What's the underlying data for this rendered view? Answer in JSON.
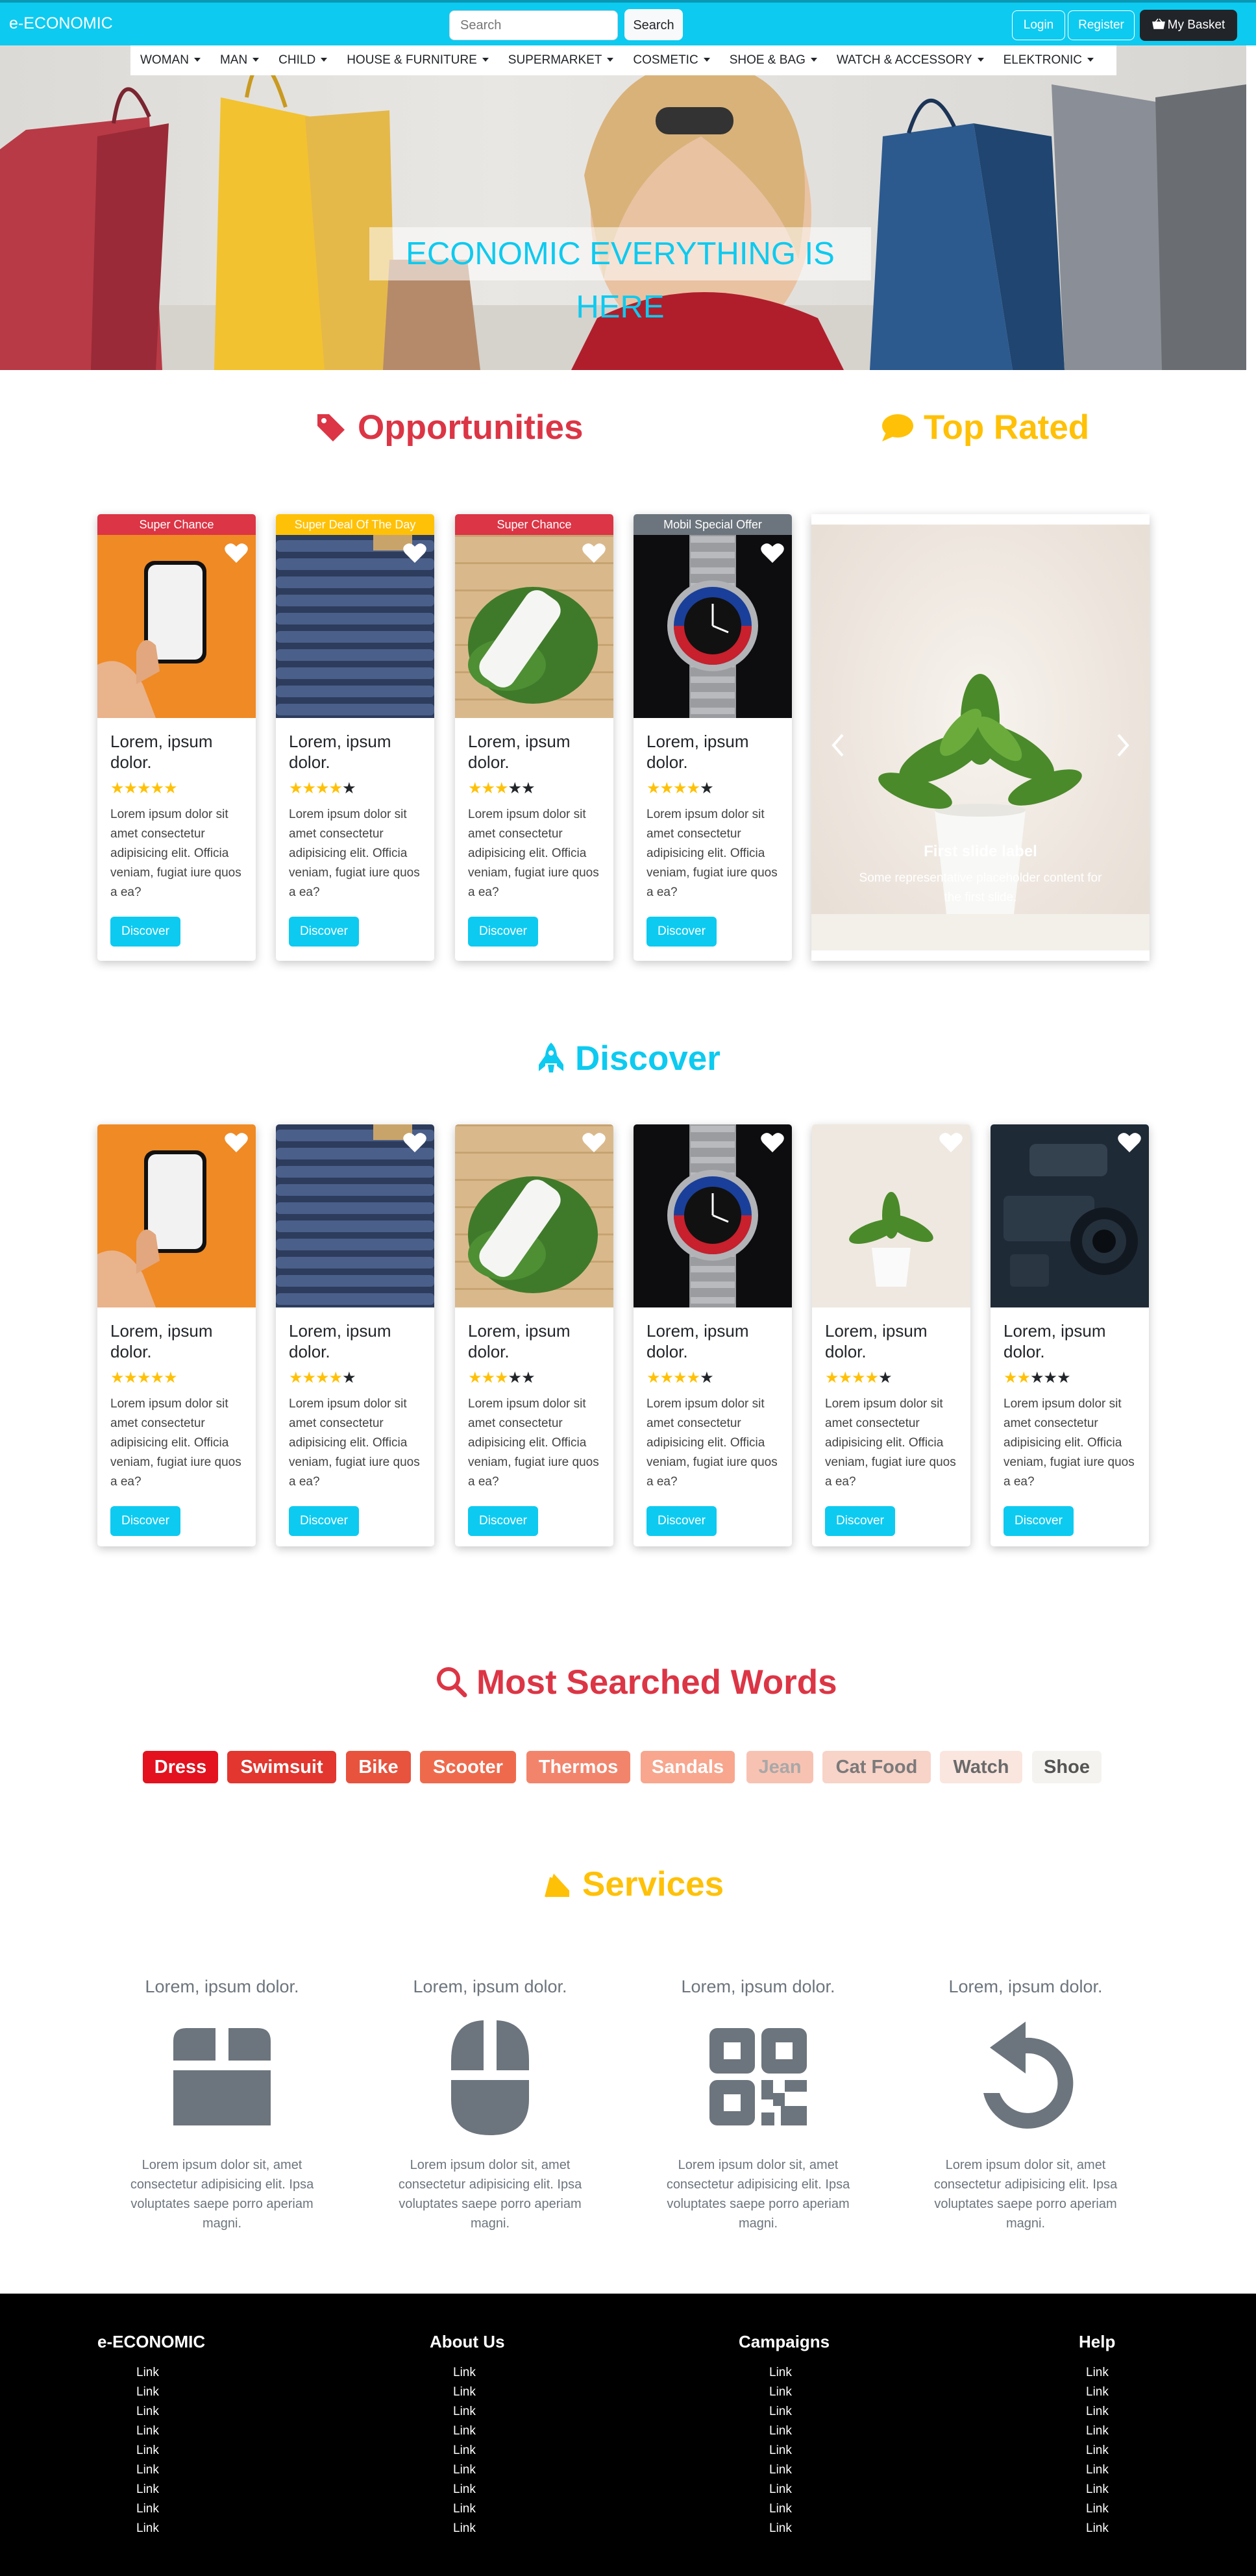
{
  "navbar": {
    "brand": "e-ECONOMIC",
    "search_placeholder": "Search",
    "search_button": "Search",
    "login": "Login",
    "register": "Register",
    "basket": "My Basket",
    "accent_color": "#0dcaf0"
  },
  "categories": [
    "WOMAN",
    "MAN",
    "CHILD",
    "HOUSE & FURNITURE",
    "SUPERMARKET",
    "COSMETIC",
    "SHOE & BAG",
    "WATCH & ACCESSORY",
    "ELEKTRONIC"
  ],
  "hero": {
    "title": "ECONOMIC EVERYTHING IS HERE"
  },
  "opportunities": {
    "title": "Opportunities",
    "icon": "tags-icon",
    "color": "#dc3545",
    "cards": [
      {
        "ribbon": "Super Chance",
        "ribbon_color": "#dc3545",
        "title": "Lorem, ipsum dolor.",
        "rating": 5,
        "text": "Lorem ipsum dolor sit amet consectetur adipisicing elit. Officia veniam, fugiat iure quos a ea?",
        "button": "Discover",
        "image": "phone-image"
      },
      {
        "ribbon": "Super Deal Of The Day",
        "ribbon_color": "#ffc107",
        "title": "Lorem, ipsum dolor.",
        "rating": 4,
        "text": "Lorem ipsum dolor sit amet consectetur adipisicing elit. Officia veniam, fugiat iure quos a ea?",
        "button": "Discover",
        "image": "jeans-image"
      },
      {
        "ribbon": "Super Chance",
        "ribbon_color": "#dc3545",
        "title": "Lorem, ipsum dolor.",
        "rating": 3,
        "text": "Lorem ipsum dolor sit amet consectetur adipisicing elit. Officia veniam, fugiat iure quos a ea?",
        "button": "Discover",
        "image": "cream-image"
      },
      {
        "ribbon": "Mobil Special Offer",
        "ribbon_color": "#6c757d",
        "title": "Lorem, ipsum dolor.",
        "rating": 4,
        "text": "Lorem ipsum dolor sit amet consectetur adipisicing elit. Officia veniam, fugiat iure quos a ea?",
        "button": "Discover",
        "image": "watch-image"
      }
    ]
  },
  "top_rated": {
    "title": "Top Rated",
    "icon": "comment-icon",
    "color": "#ffc107",
    "slide": {
      "label": "First slide label",
      "text": "Some representative placeholder content for the first slide."
    }
  },
  "discover": {
    "title": "Discover",
    "icon": "rocket-icon",
    "color": "#0dcaf0",
    "cards": [
      {
        "title": "Lorem, ipsum dolor.",
        "rating": 5,
        "text": "Lorem ipsum dolor sit amet consectetur adipisicing elit. Officia veniam, fugiat iure quos a ea?",
        "button": "Discover",
        "image": "phone-image"
      },
      {
        "title": "Lorem, ipsum dolor.",
        "rating": 4,
        "text": "Lorem ipsum dolor sit amet consectetur adipisicing elit. Officia veniam, fugiat iure quos a ea?",
        "button": "Discover",
        "image": "jeans-image"
      },
      {
        "title": "Lorem, ipsum dolor.",
        "rating": 3,
        "text": "Lorem ipsum dolor sit amet consectetur adipisicing elit. Officia veniam, fugiat iure quos a ea?",
        "button": "Discover",
        "image": "cream-image"
      },
      {
        "title": "Lorem, ipsum dolor.",
        "rating": 4,
        "text": "Lorem ipsum dolor sit amet consectetur adipisicing elit. Officia veniam, fugiat iure quos a ea?",
        "button": "Discover",
        "image": "watch-image"
      },
      {
        "title": "Lorem, ipsum dolor.",
        "rating": 4,
        "text": "Lorem ipsum dolor sit amet consectetur adipisicing elit. Officia veniam, fugiat iure quos a ea?",
        "button": "Discover",
        "image": "plant-image"
      },
      {
        "title": "Lorem, ipsum dolor.",
        "rating": 2,
        "text": "Lorem ipsum dolor sit amet consectetur adipisicing elit. Officia veniam, fugiat iure quos a ea?",
        "button": "Discover",
        "image": "camera-image"
      }
    ]
  },
  "searched_words": {
    "title": "Most Searched Words",
    "icon": "search-icon",
    "color": "#dc3545",
    "words": [
      {
        "label": "Dress",
        "bg": "#e3121e",
        "fg": "#ffffff"
      },
      {
        "label": "Swimsuit",
        "bg": "#e2362e",
        "fg": "#ffffff"
      },
      {
        "label": "Bike",
        "bg": "#e8533e",
        "fg": "#ffffff"
      },
      {
        "label": "Scooter",
        "bg": "#ef6a4c",
        "fg": "#ffffff"
      },
      {
        "label": "Thermos",
        "bg": "#f3846c",
        "fg": "#ffffff"
      },
      {
        "label": "Sandals",
        "bg": "#f8a68e",
        "fg": "#ffffff"
      },
      {
        "label": "Jean",
        "bg": "#f8c2b2",
        "fg": "#a8a8a8"
      },
      {
        "label": "Cat Food",
        "bg": "#f8d3c8",
        "fg": "#7a7a7a"
      },
      {
        "label": "Watch",
        "bg": "#fae6df",
        "fg": "#6a6a6a"
      },
      {
        "label": "Shoe",
        "bg": "#f5f3ef",
        "fg": "#555555"
      }
    ]
  },
  "services": {
    "title": "Services",
    "icon": "bullhorn-icon",
    "color": "#ffc107",
    "items": [
      {
        "title": "Lorem, ipsum dolor.",
        "icon": "box-icon",
        "text": "Lorem ipsum dolor sit, amet consectetur adipisicing elit. Ipsa voluptates saepe porro aperiam magni."
      },
      {
        "title": "Lorem, ipsum dolor.",
        "icon": "mouse-icon",
        "text": "Lorem ipsum dolor sit, amet consectetur adipisicing elit. Ipsa voluptates saepe porro aperiam magni."
      },
      {
        "title": "Lorem, ipsum dolor.",
        "icon": "qr-code-icon",
        "text": "Lorem ipsum dolor sit, amet consectetur adipisicing elit. Ipsa voluptates saepe porro aperiam magni."
      },
      {
        "title": "Lorem, ipsum dolor.",
        "icon": "undo-icon",
        "text": "Lorem ipsum dolor sit, amet consectetur adipisicing elit. Ipsa voluptates saepe porro aperiam magni."
      }
    ]
  },
  "footer": {
    "columns": [
      {
        "title": "e-ECONOMIC",
        "links": [
          "Link",
          "Link",
          "Link",
          "Link",
          "Link",
          "Link",
          "Link",
          "Link",
          "Link"
        ]
      },
      {
        "title": "About Us",
        "links": [
          "Link",
          "Link",
          "Link",
          "Link",
          "Link",
          "Link",
          "Link",
          "Link",
          "Link"
        ]
      },
      {
        "title": "Campaigns",
        "links": [
          "Link",
          "Link",
          "Link",
          "Link",
          "Link",
          "Link",
          "Link",
          "Link",
          "Link"
        ]
      },
      {
        "title": "Help",
        "links": [
          "Link",
          "Link",
          "Link",
          "Link",
          "Link",
          "Link",
          "Link",
          "Link",
          "Link"
        ]
      }
    ]
  }
}
